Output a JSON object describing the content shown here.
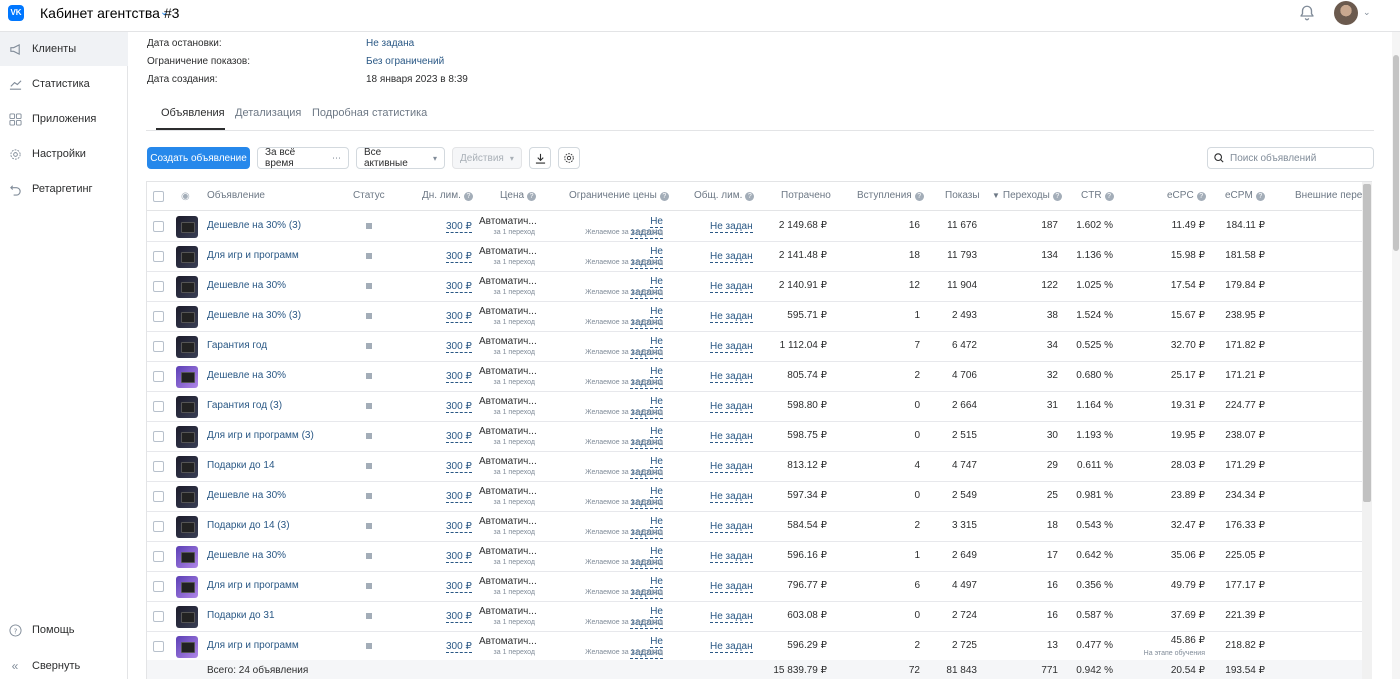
{
  "header": {
    "cabinet_title": "Кабинет агентства #3",
    "logo_text": "VK"
  },
  "sidebar": {
    "items": [
      {
        "label": "Клиенты",
        "icon": "megaphone-icon",
        "active": true
      },
      {
        "label": "Статистика",
        "icon": "chart-icon",
        "active": false
      },
      {
        "label": "Приложения",
        "icon": "apps-icon",
        "active": false
      },
      {
        "label": "Настройки",
        "icon": "gear-icon",
        "active": false
      },
      {
        "label": "Ретаргетинг",
        "icon": "retarget-icon",
        "active": false
      }
    ],
    "help": "Помощь",
    "collapse": "Свернуть"
  },
  "info": {
    "stop_date_label": "Дата остановки:",
    "stop_date_value": "Не задана",
    "impressions_limit_label": "Ограничение показов:",
    "impressions_limit_value": "Без ограничений",
    "created_label": "Дата создания:",
    "created_value": "18 января 2023 в 8:39"
  },
  "tabs": [
    "Объявления",
    "Детализация",
    "Подробная статистика"
  ],
  "toolbar": {
    "create_label": "Создать объявление",
    "period_label": "За всё время",
    "filter_label": "Все активные",
    "actions_label": "Действия",
    "search_placeholder": "Поиск объявлений"
  },
  "table": {
    "columns": {
      "ad": "Объявление",
      "status": "Статус",
      "daylim": "Дн. лим.",
      "price": "Цена",
      "price_limit": "Ограничение цены",
      "total_limit": "Общ. лим.",
      "spent": "Потрачено",
      "joins": "Вступления",
      "impressions": "Показы",
      "clicks": "Переходы",
      "ctr": "CTR",
      "ecpc": "eCPC",
      "ecpm": "eCPM",
      "external": "Внешние переходы"
    },
    "common": {
      "daylim": "300 ₽",
      "price_main": "Автоматич...",
      "price_sub": "за 1 переход",
      "limit_main": "Не задано",
      "limit_sub": "Желаемое за 1 переход",
      "total_limit": "Не задан",
      "learning_note": "На этапе обучения"
    },
    "rows": [
      {
        "name": "Дешевле на 30% (3)",
        "purple": false,
        "spent": "2 149.68 ₽",
        "joins": "16",
        "impr": "11 676",
        "clicks": "187",
        "ctr": "1.602 %",
        "ecpc": "11.49 ₽",
        "ecpm": "184.11 ₽"
      },
      {
        "name": "Для игр и программ",
        "purple": false,
        "spent": "2 141.48 ₽",
        "joins": "18",
        "impr": "11 793",
        "clicks": "134",
        "ctr": "1.136 %",
        "ecpc": "15.98 ₽",
        "ecpm": "181.58 ₽"
      },
      {
        "name": "Дешевле на 30%",
        "purple": false,
        "spent": "2 140.91 ₽",
        "joins": "12",
        "impr": "11 904",
        "clicks": "122",
        "ctr": "1.025 %",
        "ecpc": "17.54 ₽",
        "ecpm": "179.84 ₽"
      },
      {
        "name": "Дешевле на 30% (3)",
        "purple": false,
        "spent": "595.71 ₽",
        "joins": "1",
        "impr": "2 493",
        "clicks": "38",
        "ctr": "1.524 %",
        "ecpc": "15.67 ₽",
        "ecpm": "238.95 ₽"
      },
      {
        "name": "Гарантия год",
        "purple": false,
        "spent": "1 112.04 ₽",
        "joins": "7",
        "impr": "6 472",
        "clicks": "34",
        "ctr": "0.525 %",
        "ecpc": "32.70 ₽",
        "ecpm": "171.82 ₽"
      },
      {
        "name": "Дешевле на 30%",
        "purple": true,
        "spent": "805.74 ₽",
        "joins": "2",
        "impr": "4 706",
        "clicks": "32",
        "ctr": "0.680 %",
        "ecpc": "25.17 ₽",
        "ecpm": "171.21 ₽"
      },
      {
        "name": "Гарантия год (3)",
        "purple": false,
        "spent": "598.80 ₽",
        "joins": "0",
        "impr": "2 664",
        "clicks": "31",
        "ctr": "1.164 %",
        "ecpc": "19.31 ₽",
        "ecpm": "224.77 ₽"
      },
      {
        "name": "Для игр и программ (3)",
        "purple": false,
        "spent": "598.75 ₽",
        "joins": "0",
        "impr": "2 515",
        "clicks": "30",
        "ctr": "1.193 %",
        "ecpc": "19.95 ₽",
        "ecpm": "238.07 ₽"
      },
      {
        "name": "Подарки до 14",
        "purple": false,
        "spent": "813.12 ₽",
        "joins": "4",
        "impr": "4 747",
        "clicks": "29",
        "ctr": "0.611 %",
        "ecpc": "28.03 ₽",
        "ecpm": "171.29 ₽"
      },
      {
        "name": "Дешевле на 30%",
        "purple": false,
        "spent": "597.34 ₽",
        "joins": "0",
        "impr": "2 549",
        "clicks": "25",
        "ctr": "0.981 %",
        "ecpc": "23.89 ₽",
        "ecpm": "234.34 ₽"
      },
      {
        "name": "Подарки до 14 (3)",
        "purple": false,
        "spent": "584.54 ₽",
        "joins": "2",
        "impr": "3 315",
        "clicks": "18",
        "ctr": "0.543 %",
        "ecpc": "32.47 ₽",
        "ecpm": "176.33 ₽"
      },
      {
        "name": "Дешевле на 30%",
        "purple": true,
        "spent": "596.16 ₽",
        "joins": "1",
        "impr": "2 649",
        "clicks": "17",
        "ctr": "0.642 %",
        "ecpc": "35.06 ₽",
        "ecpm": "225.05 ₽"
      },
      {
        "name": "Для игр и программ",
        "purple": true,
        "spent": "796.77 ₽",
        "joins": "6",
        "impr": "4 497",
        "clicks": "16",
        "ctr": "0.356 %",
        "ecpc": "49.79 ₽",
        "ecpm": "177.17 ₽"
      },
      {
        "name": "Подарки до 31",
        "purple": false,
        "spent": "603.08 ₽",
        "joins": "0",
        "impr": "2 724",
        "clicks": "16",
        "ctr": "0.587 %",
        "ecpc": "37.69 ₽",
        "ecpm": "221.39 ₽"
      },
      {
        "name": "Для игр и программ",
        "purple": true,
        "spent": "596.29 ₽",
        "joins": "2",
        "impr": "2 725",
        "clicks": "13",
        "ctr": "0.477 %",
        "ecpc": "45.86 ₽",
        "ecpm": "218.82 ₽",
        "learning": true
      }
    ],
    "footer": {
      "label": "Всего: 24 объявления",
      "spent": "15 839.79 ₽",
      "joins": "72",
      "impr": "81 843",
      "clicks": "771",
      "ctr": "0.942 %",
      "ecpc": "20.54 ₽",
      "ecpm": "193.54 ₽"
    }
  },
  "colors": {
    "accent": "#2688eb",
    "link": "#2a5885",
    "vk_blue": "#0077ff"
  }
}
